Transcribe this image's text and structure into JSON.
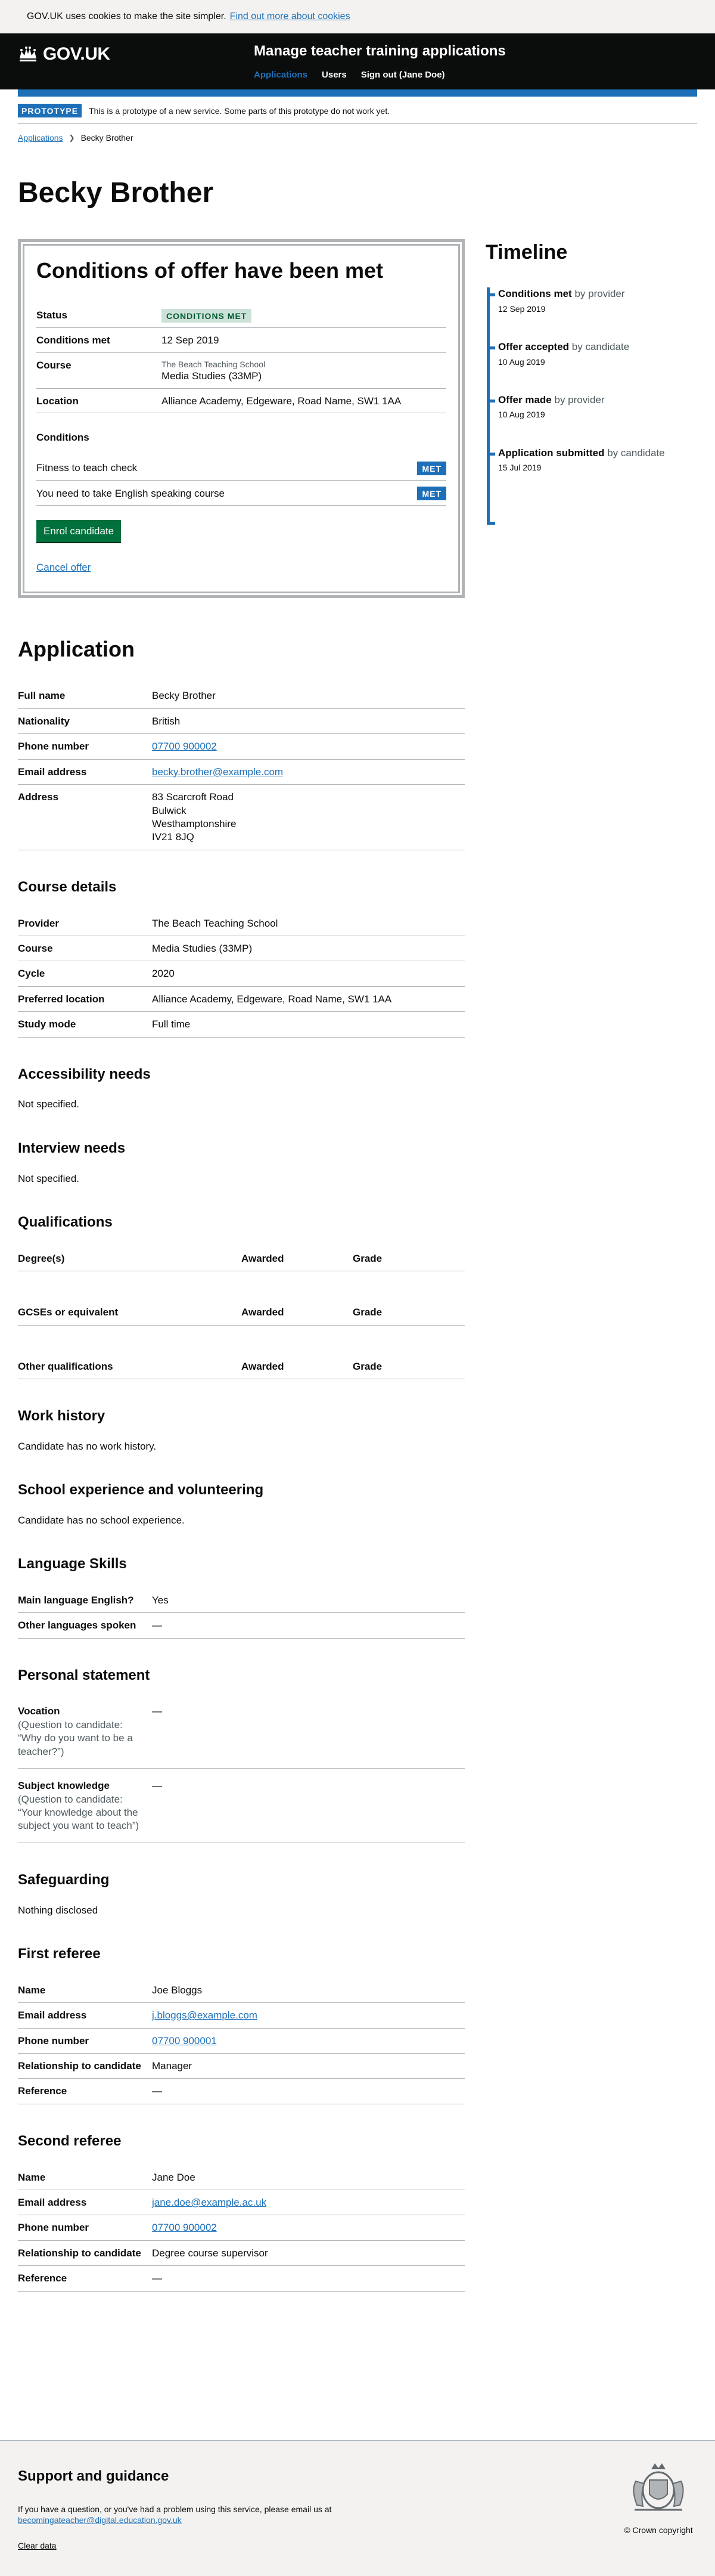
{
  "cookie": {
    "text": "GOV.UK uses cookies to make the site simpler.",
    "link": "Find out more about cookies"
  },
  "header": {
    "logo": "GOV.UK",
    "service": "Manage teacher training applications",
    "nav": [
      "Applications",
      "Users",
      "Sign out (Jane Doe)"
    ]
  },
  "phase": {
    "tag": "PROTOTYPE",
    "text": "This is a prototype of a new service. Some parts of this prototype do not work yet."
  },
  "breadcrumb": {
    "link": "Applications",
    "current": "Becky Brother"
  },
  "candidate_name": "Becky Brother",
  "offer": {
    "title": "Conditions of offer have been met",
    "status_label": "Status",
    "status_value": "CONDITIONS MET",
    "conditions_met_label": "Conditions met",
    "conditions_met_value": "12 Sep 2019",
    "course_label": "Course",
    "course_provider": "The Beach Teaching School",
    "course_value": "Media Studies (33MP)",
    "location_label": "Location",
    "location_value": "Alliance Academy, Edgeware, Road Name, SW1 1AA",
    "conditions_heading": "Conditions",
    "conditions": [
      {
        "text": "Fitness to teach check",
        "tag": "MET"
      },
      {
        "text": "You need to take English speaking course",
        "tag": "MET"
      }
    ],
    "enrol_button": "Enrol candidate",
    "cancel_link": "Cancel offer"
  },
  "timeline": {
    "title": "Timeline",
    "items": [
      {
        "event": "Conditions met",
        "by": "by provider",
        "date": "12 Sep 2019"
      },
      {
        "event": "Offer accepted",
        "by": "by candidate",
        "date": "10 Aug 2019"
      },
      {
        "event": "Offer made",
        "by": "by provider",
        "date": "10 Aug 2019"
      },
      {
        "event": "Application submitted",
        "by": "by candidate",
        "date": "15 Jul 2019"
      }
    ]
  },
  "application": {
    "title": "Application",
    "full_name_label": "Full name",
    "full_name": "Becky Brother",
    "nationality_label": "Nationality",
    "nationality": "British",
    "phone_label": "Phone number",
    "phone": "07700 900002",
    "email_label": "Email address",
    "email": "becky.brother@example.com",
    "address_label": "Address",
    "address": [
      "83 Scarcroft Road",
      "Bulwick",
      "Westhamptonshire",
      "IV21 8JQ"
    ]
  },
  "course_details": {
    "title": "Course details",
    "rows": [
      {
        "label": "Provider",
        "value": "The Beach Teaching School"
      },
      {
        "label": "Course",
        "value": "Media Studies (33MP)"
      },
      {
        "label": "Cycle",
        "value": "2020"
      },
      {
        "label": "Preferred location",
        "value": "Alliance Academy, Edgeware, Road Name, SW1 1AA"
      },
      {
        "label": "Study mode",
        "value": "Full time"
      }
    ]
  },
  "accessibility": {
    "title": "Accessibility needs",
    "text": "Not specified."
  },
  "interview": {
    "title": "Interview needs",
    "text": "Not specified."
  },
  "qualifications": {
    "title": "Qualifications",
    "awarded": "Awarded",
    "grade": "Grade",
    "groups": [
      "Degree(s)",
      "GCSEs or equivalent",
      "Other qualifications"
    ]
  },
  "work_history": {
    "title": "Work history",
    "text": "Candidate has no work history."
  },
  "school_experience": {
    "title": "School experience and volunteering",
    "text": "Candidate has no school experience."
  },
  "language": {
    "title": "Language Skills",
    "rows": [
      {
        "label": "Main language English?",
        "value": "Yes"
      },
      {
        "label": "Other languages spoken",
        "value": "—"
      }
    ]
  },
  "personal_statement": {
    "title": "Personal statement",
    "rows": [
      {
        "label": "Vocation",
        "hint": "(Question to candidate: “Why do you want to be a teacher?”)",
        "value": "—"
      },
      {
        "label": "Subject knowledge",
        "hint": "(Question to candidate: “Your knowledge about the subject you want to teach”)",
        "value": "—"
      }
    ]
  },
  "safeguarding": {
    "title": "Safeguarding",
    "text": "Nothing disclosed"
  },
  "first_referee": {
    "title": "First referee",
    "name_label": "Name",
    "name": "Joe Bloggs",
    "email_label": "Email address",
    "email": "j.bloggs@example.com",
    "phone_label": "Phone number",
    "phone": "07700 900001",
    "relationship_label": "Relationship to candidate",
    "relationship": "Manager",
    "reference_label": "Reference",
    "reference": "—"
  },
  "second_referee": {
    "title": "Second referee",
    "name_label": "Name",
    "name": "Jane Doe",
    "email_label": "Email address",
    "email": "jane.doe@example.ac.uk",
    "phone_label": "Phone number",
    "phone": "07700 900002",
    "relationship_label": "Relationship to candidate",
    "relationship": "Degree course supervisor",
    "reference_label": "Reference",
    "reference": "—"
  },
  "footer": {
    "title": "Support and guidance",
    "text": "If you have a question, or you've had a problem using this service, please email us at",
    "email": "becomingateacher@digital.education.gov.uk",
    "clear": "Clear data",
    "copyright": "© Crown copyright"
  }
}
